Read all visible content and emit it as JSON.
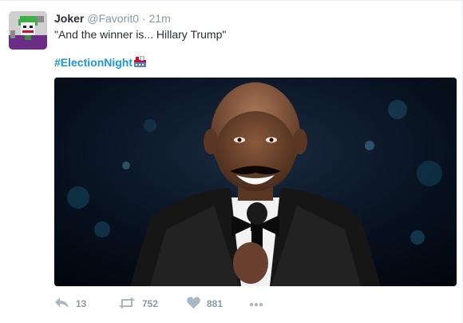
{
  "tweet": {
    "name": "Joker",
    "handle": "@Favorit0",
    "separator": "·",
    "time": "21m",
    "text": "\"And the winner is... Hillary Trump\"",
    "hashtag": "#ElectionNight",
    "hashtag_emoji": "ballot-box-icon"
  },
  "actions": {
    "reply_count": "13",
    "retweet_count": "752",
    "like_count": "881"
  },
  "colors": {
    "link": "#1b95e0",
    "secondary_text": "#8899a6",
    "icon_gray": "#aab8c2",
    "primary_text": "#292f33"
  }
}
